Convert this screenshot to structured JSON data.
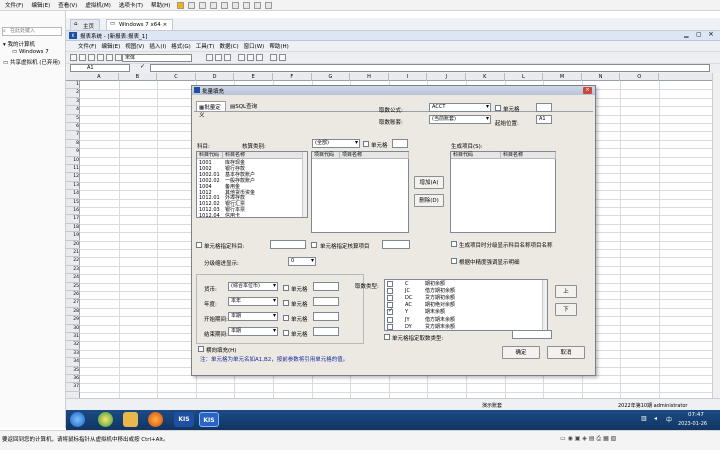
{
  "host": {
    "menu": [
      "文件(F)",
      "编辑(E)",
      "查看(V)",
      "虚拟机(M)",
      "选项卡(T)",
      "帮助(H)"
    ],
    "library_search_placeholder": "在此处键入",
    "tree": [
      "我的计算机",
      "Windows 7",
      "共享虚拟机 (已弃用)"
    ],
    "tabs": [
      "主页",
      "Windows 7 x64"
    ],
    "status_text": "要返回到您的计算机，请将鼠标指针从虚拟机中移出或按 Ctrl+Alt。"
  },
  "kis": {
    "title": "报表系统 - [新报表:报表_1]",
    "menu": [
      "文件(F)",
      "编辑(E)",
      "视图(V)",
      "插入(I)",
      "格式(G)",
      "工具(T)",
      "数据(C)",
      "窗口(W)",
      "帮助(H)"
    ],
    "font_name": "宋体",
    "cell_ref": "A1",
    "columns": [
      "A",
      "B",
      "C",
      "D",
      "E",
      "F",
      "G",
      "H",
      "I",
      "J",
      "K",
      "L",
      "M",
      "N",
      "O"
    ],
    "rows": [
      "1",
      "2",
      "3",
      "4",
      "5",
      "6",
      "7",
      "8",
      "9",
      "10",
      "11",
      "12",
      "13",
      "14",
      "15",
      "16",
      "17",
      "18",
      "19",
      "20",
      "21",
      "22",
      "23",
      "24",
      "25",
      "26",
      "27",
      "28",
      "29",
      "30",
      "31",
      "32",
      "33",
      "34",
      "35",
      "36",
      "37"
    ],
    "status_mode": "演示账套",
    "status_user": "2022年第10期 administrator"
  },
  "taskbar": {
    "clock_time": "07:47",
    "clock_date": "2023-01-26",
    "kis1": "KIS",
    "kis2": "KIS"
  },
  "dialog": {
    "title": "批量填充",
    "tab_batch": "批量定义",
    "tab_sql": "SQL查询",
    "fetch_formula_label": "取数公式:",
    "fetch_formula_value": "ACCT",
    "cell_check_1": "单元格",
    "fetch_account_label": "取数账套:",
    "fetch_account_value": "(当前账套)",
    "start_pos_label": "起始位置:",
    "start_pos_value": "A1",
    "subject_label": "科目:",
    "subject_columns": [
      "科目代码",
      "科目名称"
    ],
    "subjects": [
      {
        "code": "1001",
        "name": "库存现金"
      },
      {
        "code": "1002",
        "name": "银行存款"
      },
      {
        "code": "1002.01",
        "name": "基本存款账户"
      },
      {
        "code": "1002.02",
        "name": "一般存款账户"
      },
      {
        "code": "1004",
        "name": "备用金"
      },
      {
        "code": "1012",
        "name": "其他货币资金"
      },
      {
        "code": "1012.01",
        "name": "外埠存款"
      },
      {
        "code": "1012.02",
        "name": "银行汇票"
      },
      {
        "code": "1012.03",
        "name": "银行本票"
      },
      {
        "code": "1012.04",
        "name": "信用卡"
      }
    ],
    "aux_label": "核算类别:",
    "aux_select": "(全部)",
    "aux_check": "单元格",
    "aux_columns": [
      "项目代码",
      "项目名称"
    ],
    "gen_label": "生成项目(S):",
    "gen_columns": [
      "科目代码",
      "科目名称"
    ],
    "add_button": "增加(A)",
    "delete_button": "删除(D)",
    "opt_cell_subject": "单元格指定科目:",
    "opt_cell_aux": "单元格指定核算项目",
    "opt_gen_name": "生成项目时分级显示科目名称项目名称",
    "opt_show_detail": "根据中精度强调显示明细",
    "level_label": "分级缩进显示:",
    "level_value": "0",
    "currency_label": "货币:",
    "currency_value": "(综合本位币)",
    "year_label": "年度:",
    "year_value": "本年",
    "start_period_label": "开始期间:",
    "start_period_value": "本期",
    "end_period_label": "结束期间:",
    "end_period_value": "本期",
    "cell_check": "单元格",
    "fetch_type_label": "取数类型:",
    "fetch_types": [
      {
        "code": "C",
        "name": "期初余额",
        "checked": false
      },
      {
        "code": "JC",
        "name": "借方期初余额",
        "checked": false
      },
      {
        "code": "DC",
        "name": "贷方期初余额",
        "checked": false
      },
      {
        "code": "AC",
        "name": "期初绝对余额",
        "checked": false
      },
      {
        "code": "Y",
        "name": "期末余额",
        "checked": true
      },
      {
        "code": "JY",
        "name": "借方期末余额",
        "checked": false
      },
      {
        "code": "DY",
        "name": "贷方期末余额",
        "checked": false
      }
    ],
    "up_button": "上",
    "down_button": "下",
    "fetch_type_cell": "单元格指定取数类型:",
    "horizontal_fill": "横向填充(H)",
    "note": "注：单元格为单元名如A1,B2，按前参数将引用单元格的值。",
    "ok_button": "确定",
    "cancel_button": "取消",
    "colors": {
      "note": "#1428a0",
      "titlebar": "#bfcadb",
      "accent": "#1c3a7a"
    }
  }
}
